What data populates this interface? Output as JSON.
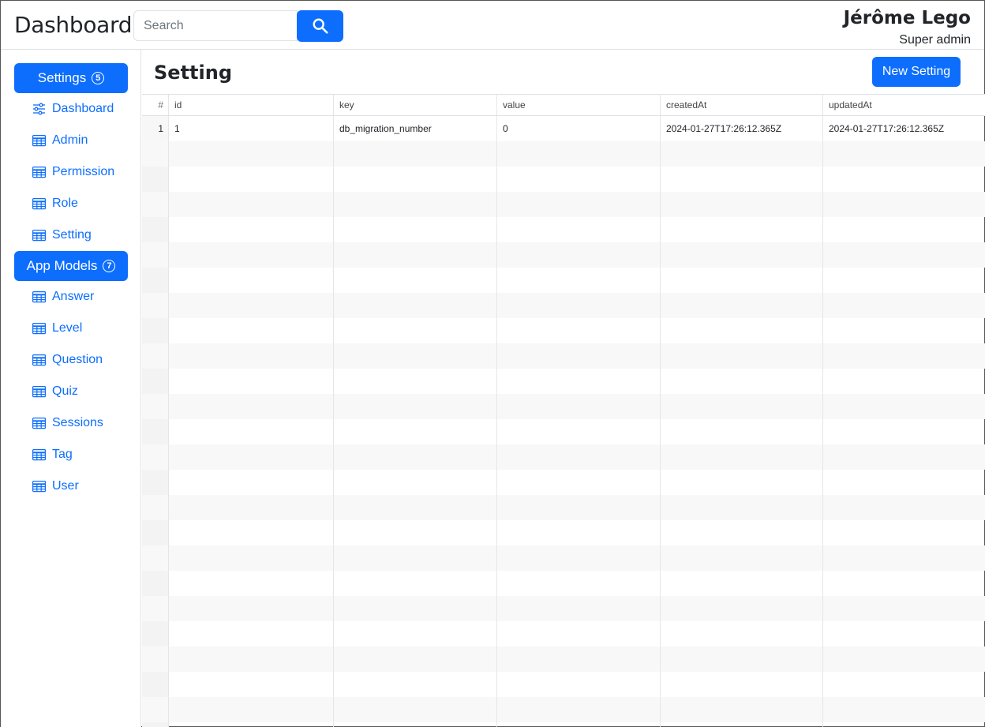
{
  "header": {
    "brand": "Dashboard",
    "search_placeholder": "Search",
    "search_icon": "search-icon",
    "user_name": "Jérôme Lego",
    "user_role": "Super admin"
  },
  "sidebar": {
    "groups": [
      {
        "label": "Settings",
        "badge": "5",
        "items": [
          {
            "label": "Dashboard",
            "icon": "sliders-icon"
          },
          {
            "label": "Admin",
            "icon": "table-icon"
          },
          {
            "label": "Permission",
            "icon": "table-icon"
          },
          {
            "label": "Role",
            "icon": "table-icon"
          },
          {
            "label": "Setting",
            "icon": "table-icon"
          }
        ]
      },
      {
        "label": "App Models",
        "badge": "7",
        "items": [
          {
            "label": "Answer",
            "icon": "table-icon"
          },
          {
            "label": "Level",
            "icon": "table-icon"
          },
          {
            "label": "Question",
            "icon": "table-icon"
          },
          {
            "label": "Quiz",
            "icon": "table-icon"
          },
          {
            "label": "Sessions",
            "icon": "table-icon"
          },
          {
            "label": "Tag",
            "icon": "table-icon"
          },
          {
            "label": "User",
            "icon": "table-icon"
          }
        ]
      }
    ]
  },
  "main": {
    "title": "Setting",
    "new_button_label": "New Setting",
    "table": {
      "columns": [
        "#",
        "id",
        "key",
        "value",
        "createdAt",
        "updatedAt"
      ],
      "rows": [
        [
          "1",
          "1",
          "db_migration_number",
          "0",
          "2024-01-27T17:26:12.365Z",
          "2024-01-27T17:26:12.365Z"
        ]
      ]
    }
  },
  "colors": {
    "accent": "#0d6efd",
    "text": "#212529",
    "border": "#dee2e6"
  }
}
